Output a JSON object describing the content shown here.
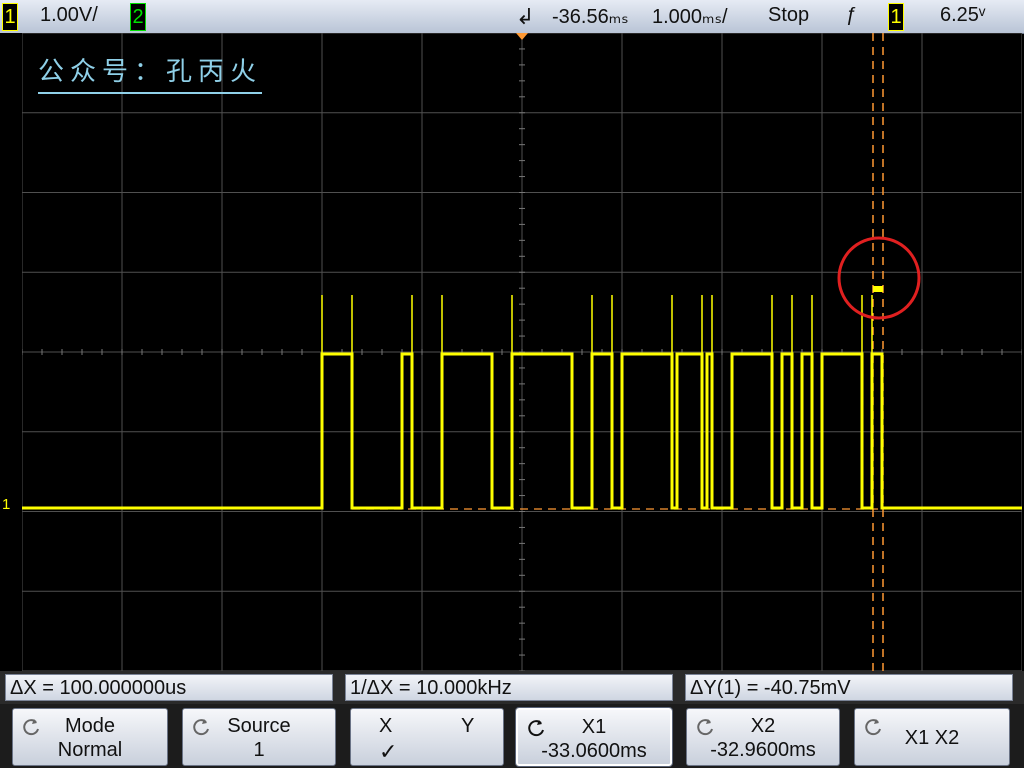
{
  "status_bar": {
    "ch1_number": "1",
    "ch1_scale": "1.00V/",
    "ch2_number": "2",
    "trigger_arrow": "↲",
    "delay": "-36.56ₘₛ",
    "timebase": "1.000ₘₛ/",
    "run_state": "Stop",
    "trigger_slope": "ƒ",
    "trigger_source": "1",
    "trigger_level": "6.25ᵛ"
  },
  "watermark": "公众号：孔丙火",
  "ground_marker": "1",
  "measurements": {
    "delta_x": "ΔX = 100.000000us",
    "inv_delta_x": "1/ΔX = 10.000kHz",
    "delta_y": "ΔY(1) = -40.75mV"
  },
  "softkeys": {
    "mode": {
      "line1": "Mode",
      "line2": "Normal"
    },
    "source": {
      "line1": "Source",
      "line2": "1"
    },
    "xy": {
      "x": "X",
      "y": "Y",
      "check": "✓"
    },
    "x1": {
      "line1": "X1",
      "line2": "-33.0600ms"
    },
    "x2": {
      "line1": "X2",
      "line2": "-32.9600ms"
    },
    "x1x2": {
      "line1": "X1  X2"
    }
  },
  "colors": {
    "trace": "#ffff00",
    "cursor": "#ff9933",
    "grid": "#505050",
    "annotation_circle": "#e02020"
  }
}
